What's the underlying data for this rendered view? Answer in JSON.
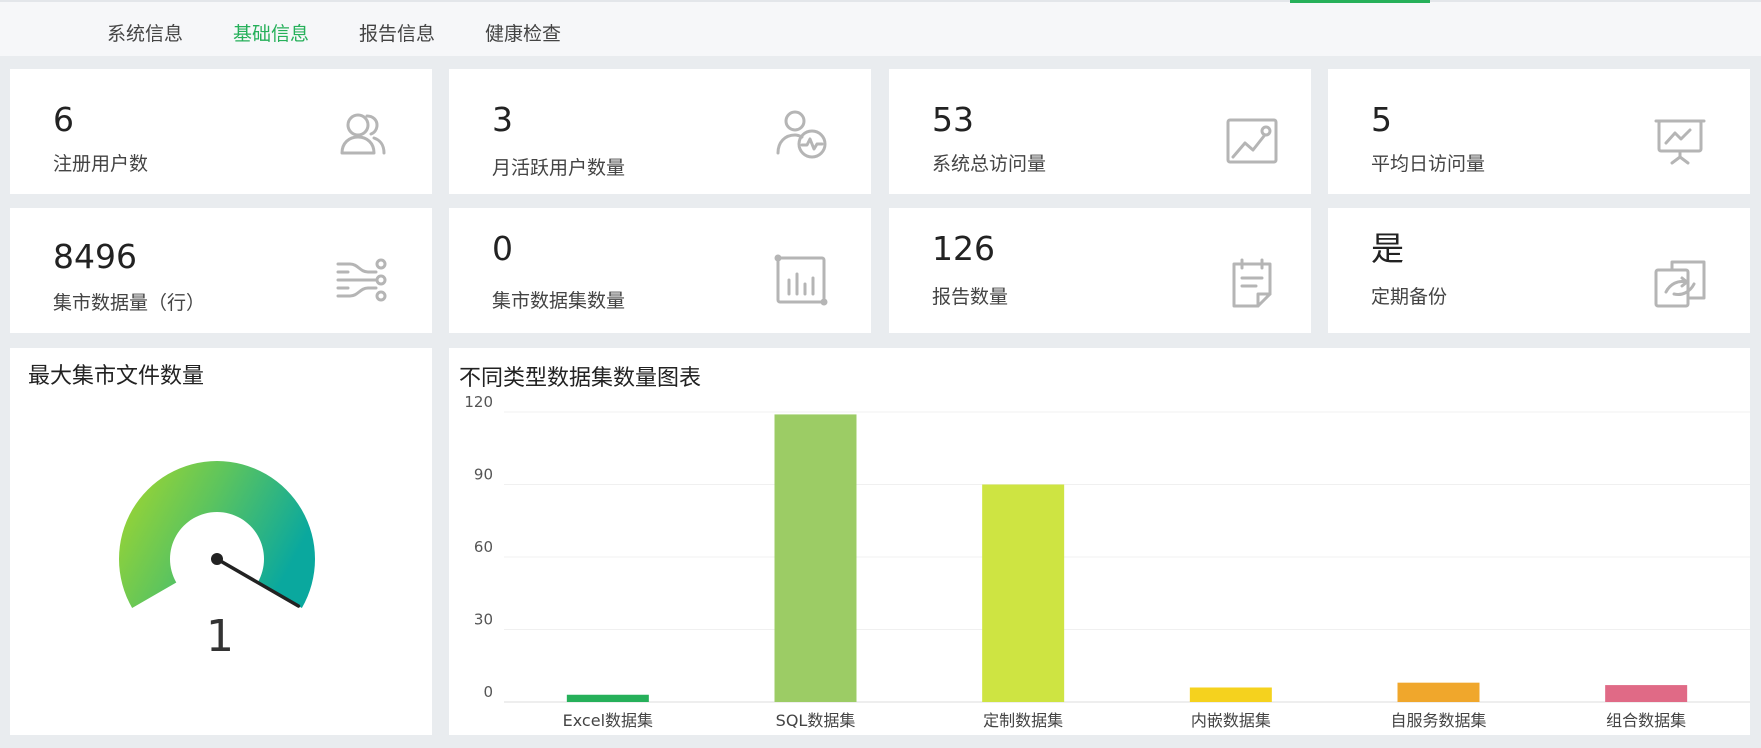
{
  "tabs": [
    {
      "label": "系统信息",
      "active": false
    },
    {
      "label": "基础信息",
      "active": true
    },
    {
      "label": "报告信息",
      "active": false
    },
    {
      "label": "健康检查",
      "active": false
    }
  ],
  "stats": [
    {
      "value": "6",
      "label": "注册用户数",
      "icon": "users-icon"
    },
    {
      "value": "3",
      "label": "月活跃用户数量",
      "icon": "user-activity-icon"
    },
    {
      "value": "53",
      "label": "系统总访问量",
      "icon": "line-chart-image-icon"
    },
    {
      "value": "5",
      "label": "平均日访问量",
      "icon": "presentation-board-icon"
    },
    {
      "value": "8496",
      "label": "集市数据量（行）",
      "icon": "data-flow-icon"
    },
    {
      "value": "0",
      "label": "集市数据集数量",
      "icon": "bar-chart-icon"
    },
    {
      "value": "126",
      "label": "报告数量",
      "icon": "report-clipboard-icon"
    },
    {
      "value": "是",
      "label": "定期备份",
      "icon": "backup-sync-icon"
    }
  ],
  "gauge": {
    "title": "最大集市文件数量",
    "value": "1",
    "colors": {
      "start": "#a8d82a",
      "mid": "#5cc45e",
      "end": "#0aa89e"
    }
  },
  "chart": {
    "title": "不同类型数据集数量图表"
  },
  "chart_data": {
    "type": "bar",
    "categories": [
      "Excel数据集",
      "SQL数据集",
      "定制数据集",
      "内嵌数据集",
      "自服务数据集",
      "组合数据集"
    ],
    "values": [
      3,
      119,
      90,
      6,
      8,
      7
    ],
    "colors": [
      "#26b05a",
      "#9ccc65",
      "#cee442",
      "#f5d21e",
      "#f0a72c",
      "#e06a86"
    ],
    "yticks": [
      0,
      30,
      60,
      90,
      120
    ],
    "ylim": [
      0,
      120
    ]
  }
}
